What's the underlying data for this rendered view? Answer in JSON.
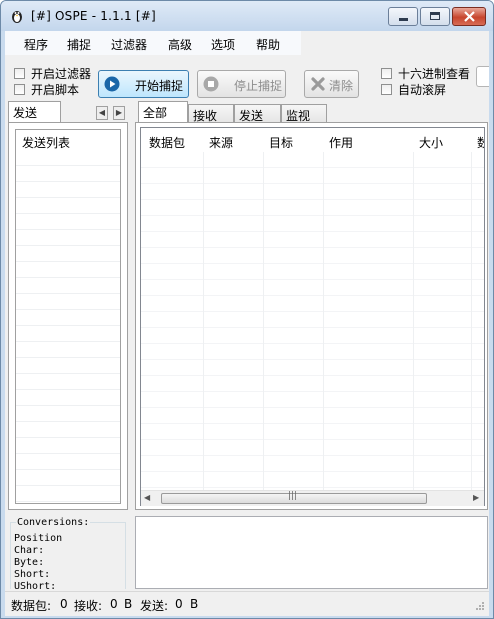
{
  "window": {
    "title": "[#] OSPE - 1.1.1 [#]"
  },
  "menu": [
    "程序",
    "捕捉",
    "过滤器",
    "高级",
    "选项",
    "帮助"
  ],
  "options": {
    "enable_filter": "开启过滤器",
    "enable_script": "开启脚本",
    "hex_view": "十六进制查看",
    "auto_scroll": "自动滚屏"
  },
  "toolbar": {
    "start_capture": "开始捕捉",
    "stop_capture": "停止捕捉",
    "clear": "清除"
  },
  "send_panel": {
    "tab": "发送",
    "list_header": "发送列表"
  },
  "tabs": [
    "全部",
    "接收",
    "发送",
    "监视"
  ],
  "columns": [
    "数据包",
    "来源",
    "目标",
    "作用",
    "大小",
    "数"
  ],
  "conversions": {
    "title": "Conversions:",
    "rows": [
      "Position",
      "Char:",
      "Byte:",
      "Short:",
      "UShort:"
    ]
  },
  "status": {
    "packets_label": "数据包:",
    "packets_value": "0",
    "recv_label": "接收:",
    "recv_value": "0",
    "recv_unit": "B",
    "sent_label": "发送:",
    "sent_value": "0",
    "sent_unit": "B"
  },
  "colors": {
    "titlebar": "#c9dbee",
    "close": "#c7452d",
    "accent": "#3c7fb1"
  }
}
